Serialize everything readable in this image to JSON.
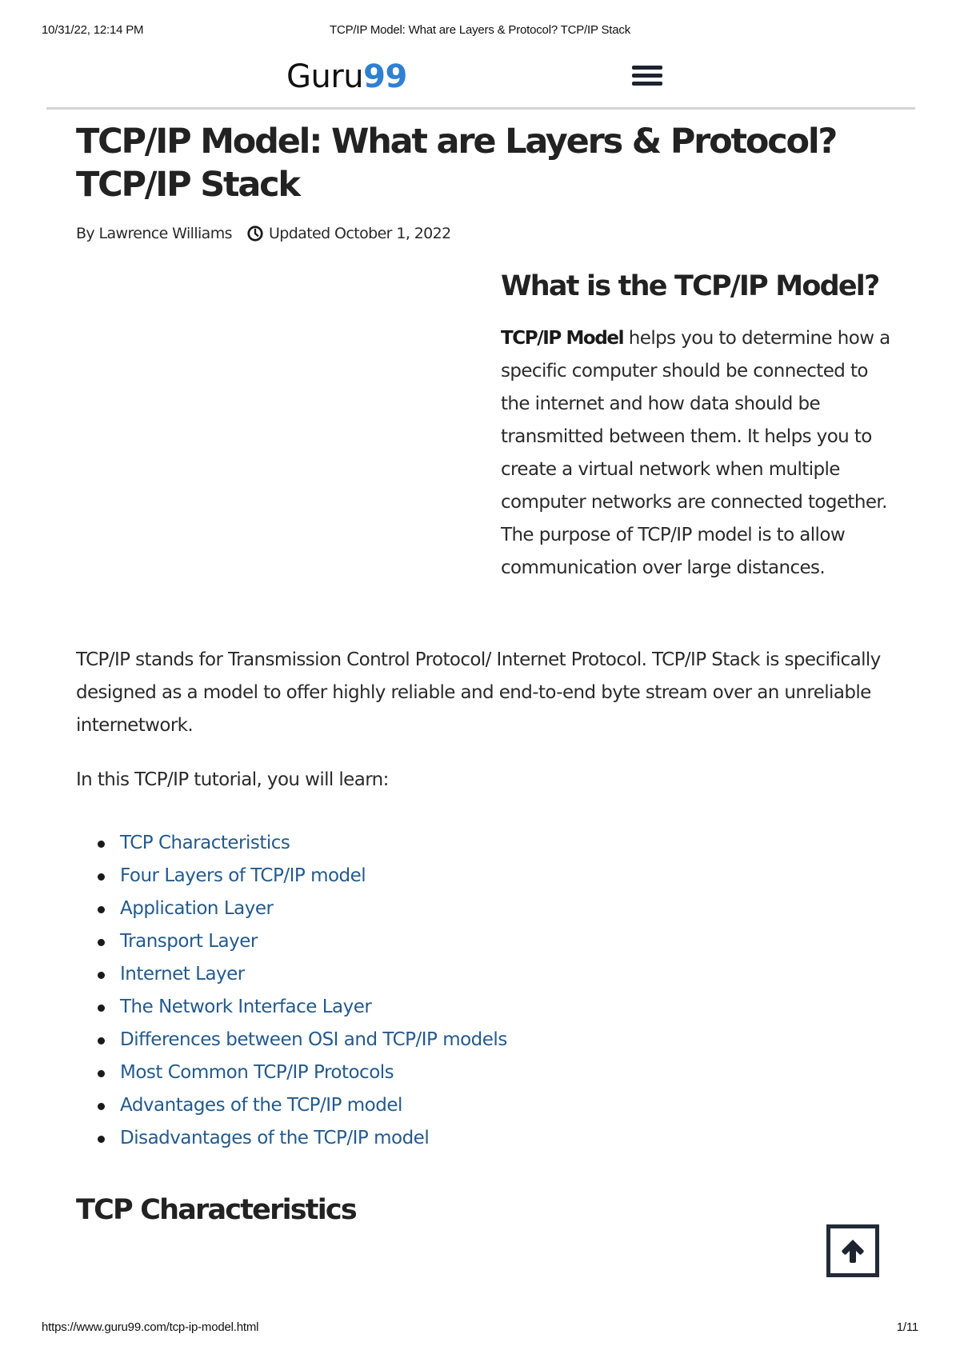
{
  "print_header": {
    "datetime": "10/31/22, 12:14 PM",
    "title": "TCP/IP Model: What are Layers & Protocol? TCP/IP Stack"
  },
  "site_header": {
    "logo_text": "Guru",
    "logo_number": "99",
    "menu_icon": "hamburger-menu-icon"
  },
  "colors": {
    "logo_accent": "#2f80d1",
    "link": "#245a8e",
    "text": "#222222",
    "button_border": "#232b39"
  },
  "article": {
    "title": "TCP/IP Model: What are Layers & Protocol? TCP/IP Stack",
    "author": "By Lawrence Williams",
    "updated_icon": "clock-icon",
    "updated": "Updated October 1, 2022",
    "what_is_heading": "What is the TCP/IP Model?",
    "what_is_bold": "TCP/IP Model",
    "what_is_text": " helps you to determine how a specific computer should be connected to the internet and how data should be transmitted between them. It helps you to create a virtual network when multiple computer networks are connected together. The purpose of TCP/IP model is to allow communication over large distances.",
    "intro_paragraph": "TCP/IP stands for Transmission Control Protocol/ Internet Protocol. TCP/IP Stack is specifically designed as a model to offer highly reliable and end-to-end byte stream over an unreliable internetwork.",
    "learn_intro": "In this TCP/IP tutorial, you will learn:",
    "toc": [
      "TCP Characteristics",
      "Four Layers of TCP/IP model",
      "Application Layer",
      "Transport Layer",
      "Internet Layer",
      "The Network Interface Layer",
      "Differences between OSI and TCP/IP models",
      "Most Common TCP/IP Protocols",
      "Advantages of the TCP/IP model",
      "Disadvantages of the TCP/IP model"
    ],
    "tcp_char_heading": "TCP Characteristics"
  },
  "back_to_top": {
    "icon": "arrow-up-icon"
  },
  "print_footer": {
    "url": "https://www.guru99.com/tcp-ip-model.html",
    "page": "1/11"
  }
}
